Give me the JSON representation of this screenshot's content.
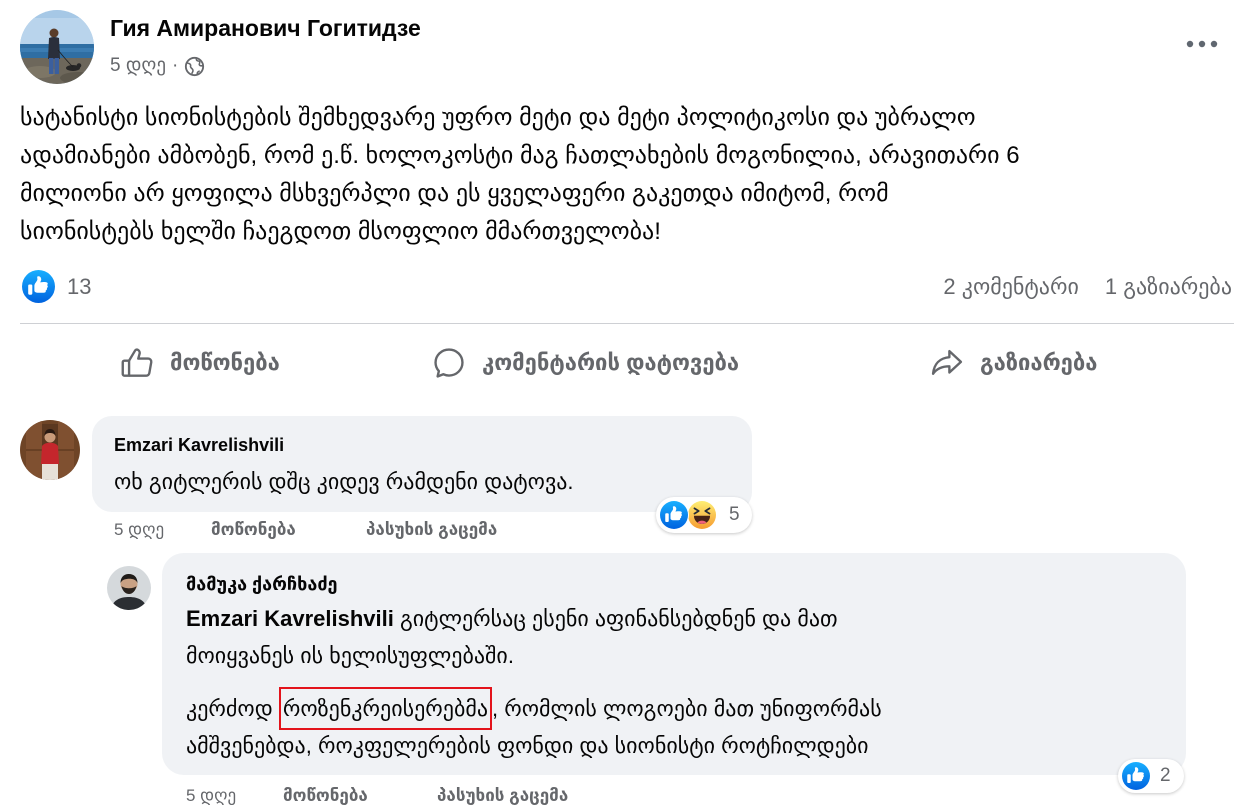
{
  "post": {
    "author": "Гия Амиранович Гогитидзе",
    "time": "5 დღე",
    "separator": "·",
    "privacy_icon": "globe-icon",
    "more_icon": "more-horizontal-icon",
    "text_lines": [
      "სატანისტი სიონისტების შემხედვარე უფრო მეტი და მეტი პოლიტიკოსი და უბრალო",
      "ადამიანები ამბობენ, რომ ე.წ. ხოლოკოსტი მაგ ჩათლახების მოგონილია, არავითარი 6",
      "მილიონი არ ყოფილა მსხვერპლი და ეს ყველაფერი გაკეთდა იმიტომ, რომ",
      "სიონისტებს ხელში ჩაეგდოთ მსოფლიო მმართველობა!"
    ],
    "reactions": {
      "icons": [
        "like-reaction-icon"
      ],
      "count": "13"
    },
    "comments_count": "2 კომენტარი",
    "shares_count": "1 გაზიარება"
  },
  "actions": [
    {
      "icon": "thumbs-up-icon",
      "label": "მოწონება"
    },
    {
      "icon": "comment-icon",
      "label": "კომენტარის დატოვება"
    },
    {
      "icon": "share-icon",
      "label": "გაზიარება"
    }
  ],
  "comments": [
    {
      "author": "Emzari Kavrelishvili",
      "text": "ოხ გიტლერის დშც კიდევ რამდენი დატოვა.",
      "reactions": {
        "icons": [
          "like-reaction-icon",
          "haha-reaction-icon"
        ],
        "count": "5"
      },
      "time": "5 დღე",
      "like_label": "მოწონება",
      "reply_label": "პასუხის გაცემა"
    },
    {
      "author": "მამუკა ქარჩხაძე",
      "paragraph1": {
        "mention": "Emzari Kavrelishvili",
        "line1_rest": "გიტლერსაც ესენი აფინანსებდნენ და მათ",
        "line2": "მოიყვანეს ის ხელისუფლებაში."
      },
      "paragraph2": {
        "line1_before": "კერძოდ",
        "line1_highlight": "როზენკრეისერებმა",
        "line1_after": ", რომლის ლოგოები მათ უნიფორმას",
        "line2": "ამშვენებდა, როკფელერების ფონდი და სიონისტი როტჩილდები"
      },
      "reactions": {
        "icons": [
          "like-reaction-icon"
        ],
        "count": "2"
      },
      "time": "5 დღე",
      "like_label": "მოწონება",
      "reply_label": "პასუხის გაცემა"
    }
  ],
  "colors": {
    "primary_text": "#050505",
    "secondary_text": "#65676b",
    "comment_bubble": "#f0f2f5",
    "divider": "#ced0d4",
    "like_blue": "#1877f2",
    "highlight_box": "#e3131b"
  }
}
